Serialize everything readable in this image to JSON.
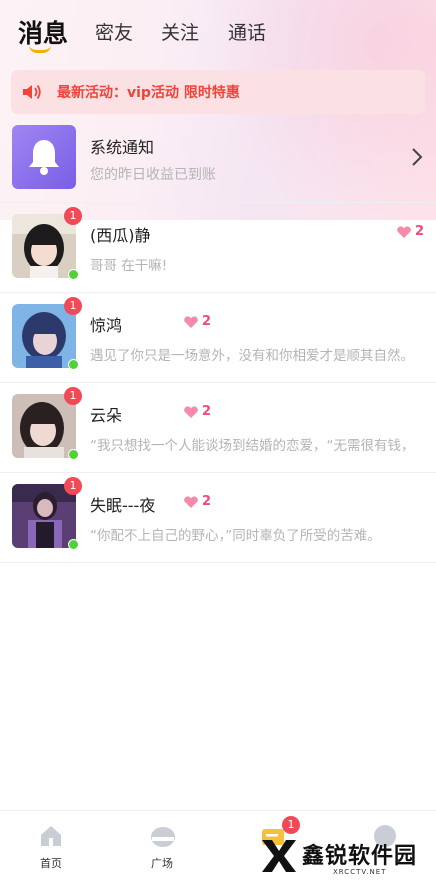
{
  "tabs": [
    {
      "label": "消息",
      "active": true
    },
    {
      "label": "密友",
      "active": false
    },
    {
      "label": "关注",
      "active": false
    },
    {
      "label": "通话",
      "active": false
    }
  ],
  "banner": {
    "text": "最新活动：vip活动 限时特惠",
    "icon": "speaker-icon",
    "color": "#f0443a"
  },
  "system_notice": {
    "title": "系统通知",
    "subtitle": "您的昨日收益已到账",
    "icon": "bell-icon"
  },
  "conversations": [
    {
      "name": "(西瓜)静",
      "message": "哥哥 在干嘛!",
      "unread": "1",
      "intimacy": "2",
      "online": true
    },
    {
      "name": "惊鸿",
      "message": "遇见了你只是一场意外，没有和你相爱才是顺其自然。",
      "unread": "1",
      "intimacy": "2",
      "online": true
    },
    {
      "name": "云朵",
      "message": "“我只想找一个人能谈场到结婚的恋爱，“无需很有钱，",
      "unread": "1",
      "intimacy": "2",
      "online": true
    },
    {
      "name": "失眠---夜",
      "message": "“你配不上自己的野心，”同时辜负了所受的苦难。",
      "unread": "1",
      "intimacy": "2",
      "online": true
    }
  ],
  "bottom_nav": [
    {
      "label": "首页",
      "icon": "home-icon"
    },
    {
      "label": "广场",
      "icon": "plaza-icon"
    },
    {
      "label": "",
      "icon": "message-icon",
      "badge": "1"
    },
    {
      "label": "",
      "icon": "profile-icon"
    }
  ],
  "watermark": {
    "text": "鑫锐软件园",
    "url": "XRCCTV.NET"
  },
  "colors": {
    "accent_pink": "#f04a7a",
    "badge_red": "#f04a57",
    "online_green": "#4fd236",
    "tab_underline": "#f2b300"
  }
}
